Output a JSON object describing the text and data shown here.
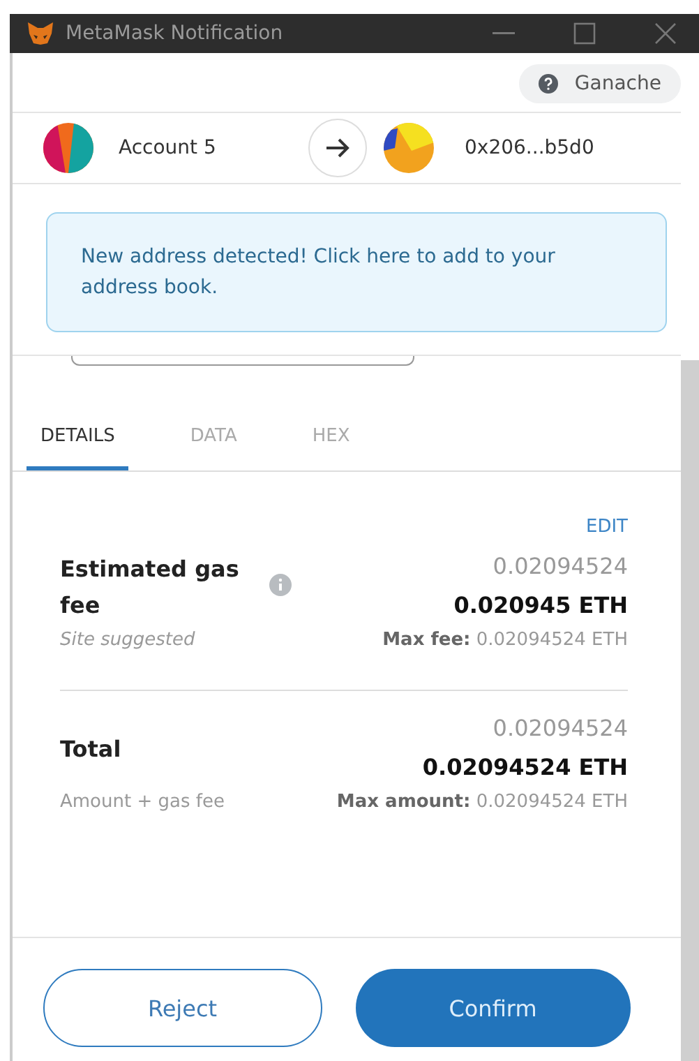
{
  "window": {
    "title": "MetaMask Notification"
  },
  "network": {
    "label": "Ganache"
  },
  "from_account": {
    "name": "Account 5"
  },
  "to_account": {
    "address": "0x206...b5d0"
  },
  "notice": {
    "text": "New address detected! Click here to add to your address book."
  },
  "tabs": [
    {
      "label": "DETAILS",
      "selected": true
    },
    {
      "label": "DATA",
      "selected": false
    },
    {
      "label": "HEX",
      "selected": false
    }
  ],
  "edit_link": "EDIT",
  "rows": [
    {
      "label": "Estimated gas fee",
      "info": true,
      "value": "0.02094524",
      "value_bold": "0.020945 ETH",
      "sublabel": "Site suggested",
      "sublabel_italic": true,
      "max": "**Max fee:** 0.02094524 ETH"
    },
    {
      "label": "Total",
      "info": false,
      "value": "0.02094524",
      "value_bold": "0.02094524 ETH",
      "sublabel": "Amount + gas fee",
      "sublabel_italic": false,
      "max": "**Max amount:** 0.02094524 ETH"
    }
  ],
  "buttons": [
    {
      "label": "Reject",
      "kind": "secondary"
    },
    {
      "label": "Confirm",
      "kind": "primary"
    }
  ]
}
